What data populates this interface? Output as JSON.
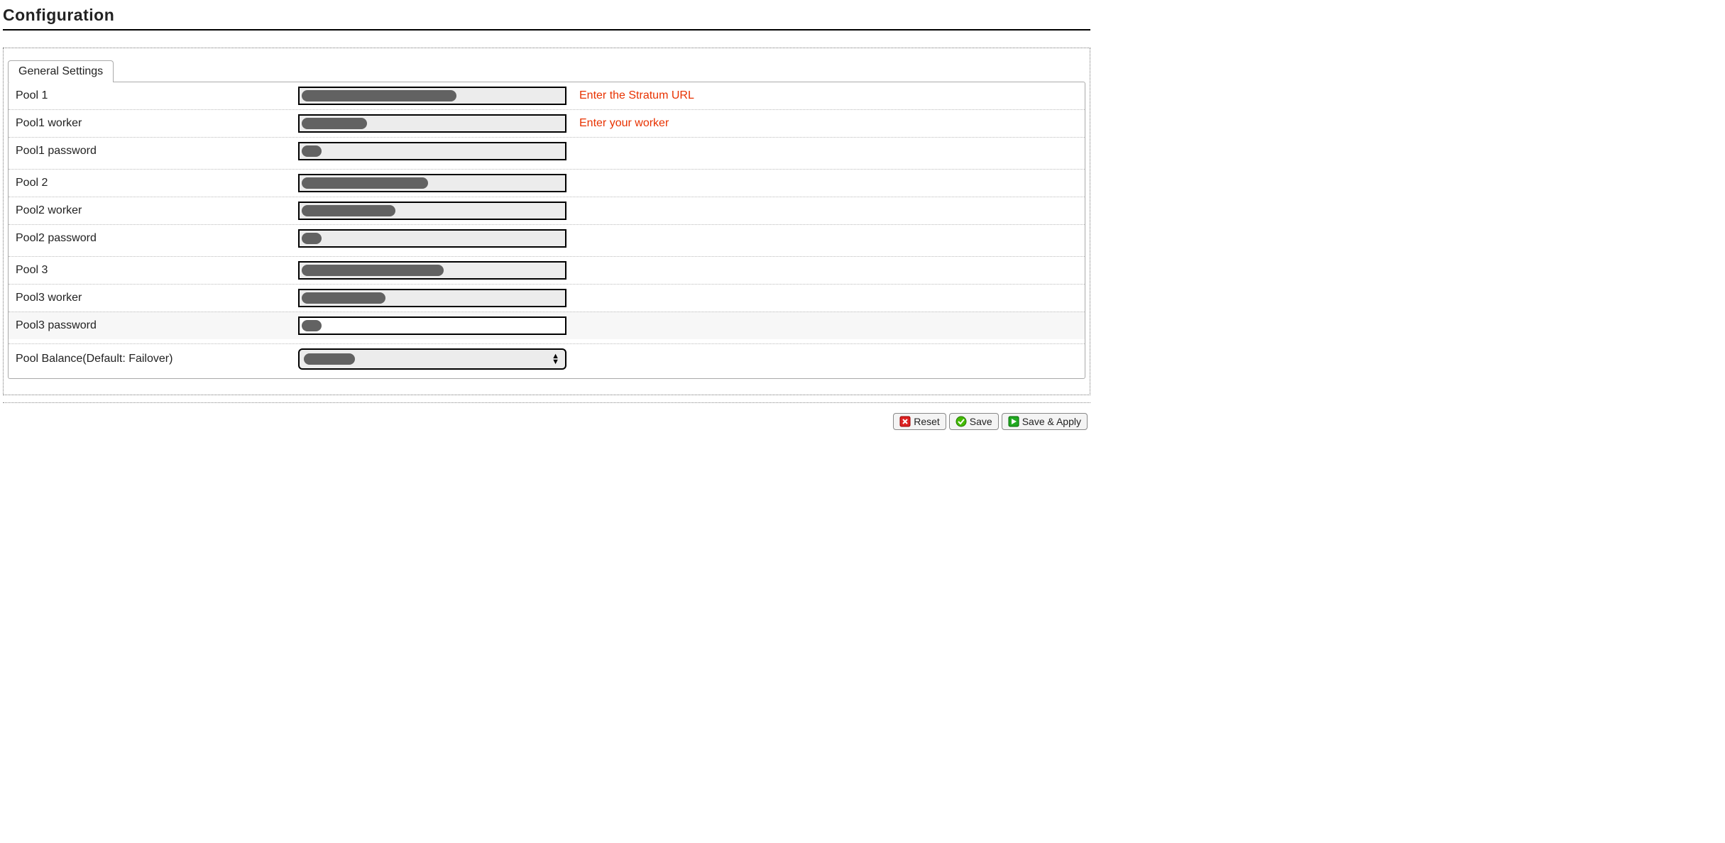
{
  "title": "Configuration",
  "tab_label": "General Settings",
  "rows": {
    "pool1": {
      "label": "Pool 1",
      "redact_w": 218,
      "hint": "Enter the Stratum URL"
    },
    "pool1_worker": {
      "label": "Pool1 worker",
      "redact_w": 92,
      "hint": "Enter your worker"
    },
    "pool1_password": {
      "label": "Pool1 password",
      "redact_w": 28
    },
    "pool2": {
      "label": "Pool 2",
      "redact_w": 178
    },
    "pool2_worker": {
      "label": "Pool2 worker",
      "redact_w": 132
    },
    "pool2_password": {
      "label": "Pool2 password",
      "redact_w": 28
    },
    "pool3": {
      "label": "Pool 3",
      "redact_w": 200
    },
    "pool3_worker": {
      "label": "Pool3 worker",
      "redact_w": 118
    },
    "pool3_password": {
      "label": "Pool3 password",
      "redact_w": 28
    },
    "pool_balance": {
      "label": "Pool Balance(Default: Failover)",
      "redact_w": 72
    }
  },
  "buttons": {
    "reset": "Reset",
    "save": "Save",
    "save_apply": "Save & Apply"
  }
}
